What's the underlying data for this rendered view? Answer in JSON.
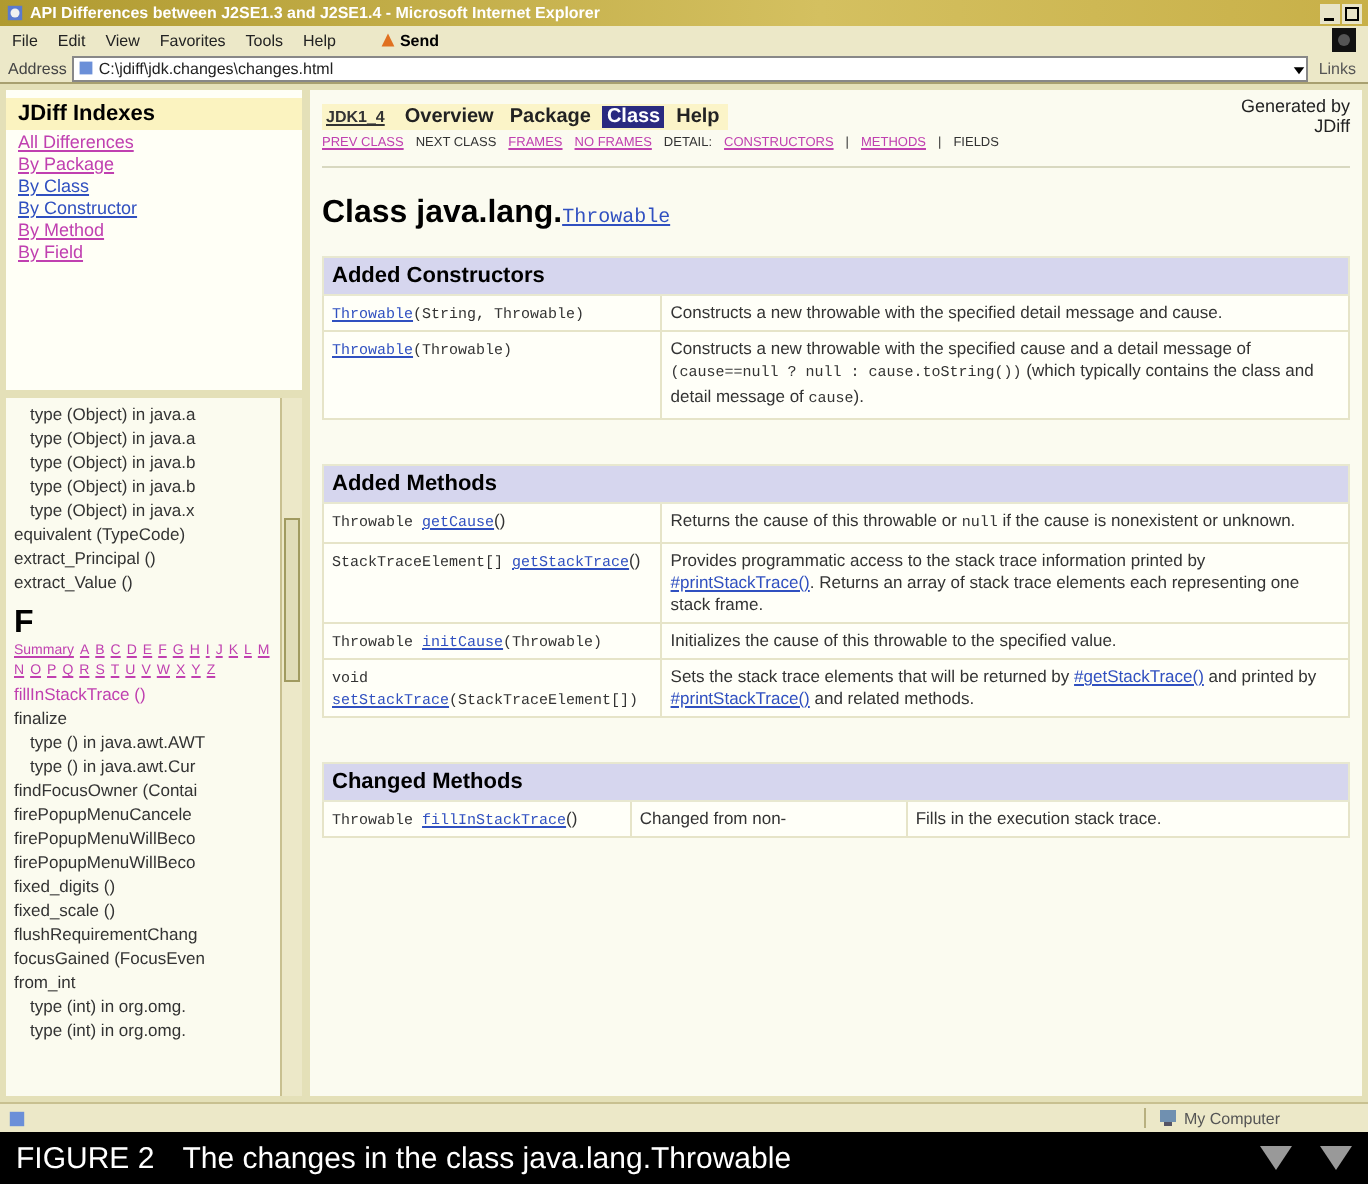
{
  "window": {
    "title": "API Differences between J2SE1.3 and J2SE1.4 - Microsoft Internet Explorer"
  },
  "menu": [
    "File",
    "Edit",
    "View",
    "Favorites",
    "Tools",
    "Help"
  ],
  "toolbar": {
    "send": "Send"
  },
  "address": {
    "label": "Address",
    "value": "C:\\jdiff\\jdk.changes\\changes.html",
    "links": "Links"
  },
  "index_frame": {
    "title": "JDiff Indexes",
    "links": [
      {
        "label": "All Differences",
        "visited": true
      },
      {
        "label": "By Package",
        "visited": true
      },
      {
        "label": "By Class",
        "visited": false
      },
      {
        "label": "By Constructor",
        "visited": false
      },
      {
        "label": "By Method",
        "visited": true
      },
      {
        "label": "By Field",
        "visited": true
      }
    ]
  },
  "list_frame": {
    "entries_top": [
      {
        "text": "type (Object) in java.a",
        "kind": "overload"
      },
      {
        "text": "type (Object) in java.a",
        "kind": "overload"
      },
      {
        "text": "type (Object) in java.b",
        "kind": "overload"
      },
      {
        "text": "type (Object) in java.b",
        "kind": "overload"
      },
      {
        "text": "type (Object) in java.x",
        "kind": "overload"
      },
      {
        "text": "equivalent (TypeCode)",
        "kind": "member"
      },
      {
        "text": "extract_Principal ()",
        "kind": "member"
      },
      {
        "text": "extract_Value ()",
        "kind": "member"
      }
    ],
    "letter": "F",
    "letter_links": [
      "Summary",
      "A",
      "B",
      "C",
      "D",
      "E",
      "F",
      "G",
      "H",
      "I",
      "J",
      "K",
      "L",
      "M",
      "N",
      "O",
      "P",
      "Q",
      "R",
      "S",
      "T",
      "U",
      "V",
      "W",
      "X",
      "Y",
      "Z"
    ],
    "entries": [
      {
        "text": "fillInStackTrace ()",
        "kind": "visited"
      },
      {
        "text": "finalize",
        "kind": "member"
      },
      {
        "text": "type () in java.awt.AWT",
        "kind": "overload"
      },
      {
        "text": "type () in java.awt.Cur",
        "kind": "overload"
      },
      {
        "text": "findFocusOwner (Contai",
        "kind": "member"
      },
      {
        "text": "firePopupMenuCancele",
        "kind": "member"
      },
      {
        "text": "firePopupMenuWillBeco",
        "kind": "member"
      },
      {
        "text": "firePopupMenuWillBeco",
        "kind": "member"
      },
      {
        "text": "fixed_digits ()",
        "kind": "member"
      },
      {
        "text": "fixed_scale ()",
        "kind": "member"
      },
      {
        "text": "flushRequirementChang",
        "kind": "member"
      },
      {
        "text": "focusGained (FocusEven",
        "kind": "member"
      },
      {
        "text": "from_int",
        "kind": "member"
      },
      {
        "text": "type (int) in org.omg.",
        "kind": "overload"
      },
      {
        "text": "type (int) in org.omg.",
        "kind": "overload"
      }
    ]
  },
  "nav": {
    "logo": "JDK1_4",
    "items": [
      {
        "label": "Overview",
        "selected": false
      },
      {
        "label": "Package",
        "selected": false
      },
      {
        "label": "Class",
        "selected": true
      },
      {
        "label": "Help",
        "selected": false
      }
    ],
    "subnav": [
      {
        "text": "PREV CLASS",
        "kind": "link"
      },
      {
        "text": "NEXT CLASS",
        "kind": "text"
      },
      {
        "text": "FRAMES",
        "kind": "link"
      },
      {
        "text": "NO FRAMES",
        "kind": "link"
      },
      {
        "text": "DETAIL:",
        "kind": "text"
      },
      {
        "text": "CONSTRUCTORS",
        "kind": "link"
      },
      {
        "text": "|",
        "kind": "text"
      },
      {
        "text": "METHODS",
        "kind": "link"
      },
      {
        "text": "|",
        "kind": "text"
      },
      {
        "text": "FIELDS",
        "kind": "text"
      }
    ],
    "generated": "Generated by JDiff"
  },
  "heading": {
    "prefix": "Class java.lang.",
    "link": "Throwable"
  },
  "sections": [
    {
      "title": "Added Constructors",
      "rows": [
        {
          "sig": [
            {
              "text": "Throwable",
              "kind": "link"
            },
            {
              "text": "(String, Throwable)",
              "kind": "code"
            }
          ],
          "cells": [
            [
              {
                "text": "Constructs a new throwable with the specified detail message and cause.",
                "kind": "text"
              }
            ]
          ]
        },
        {
          "sig": [
            {
              "text": "Throwable",
              "kind": "link"
            },
            {
              "text": "(Throwable)",
              "kind": "code"
            }
          ],
          "cells": [
            [
              {
                "text": "Constructs a new throwable with the specified cause and a detail message of ",
                "kind": "text"
              },
              {
                "text": "(cause==null ? null : cause.toString())",
                "kind": "code"
              },
              {
                "text": " (which typically contains the class and detail message of ",
                "kind": "text"
              },
              {
                "text": "cause",
                "kind": "code"
              },
              {
                "text": ").",
                "kind": "text"
              }
            ]
          ]
        }
      ]
    },
    {
      "title": "Added Methods",
      "rows": [
        {
          "sig": [
            {
              "text": "Throwable ",
              "kind": "code"
            },
            {
              "text": "getCause",
              "kind": "link"
            },
            {
              "text": "()",
              "kind": "text"
            }
          ],
          "cells": [
            [
              {
                "text": "Returns the cause of this throwable or ",
                "kind": "text"
              },
              {
                "text": "null",
                "kind": "code"
              },
              {
                "text": " if the cause is nonexistent or unknown.",
                "kind": "text"
              }
            ]
          ]
        },
        {
          "sig": [
            {
              "text": "StackTraceElement[] ",
              "kind": "code"
            },
            {
              "text": "getStackTrace",
              "kind": "link"
            },
            {
              "text": "()",
              "kind": "text"
            }
          ],
          "cells": [
            [
              {
                "text": "Provides programmatic access to the stack trace information printed by ",
                "kind": "text"
              },
              {
                "text": "#printStackTrace()",
                "kind": "link"
              },
              {
                "text": ". Returns an array of stack trace elements each representing one stack frame.",
                "kind": "text"
              }
            ]
          ]
        },
        {
          "sig": [
            {
              "text": "Throwable ",
              "kind": "code"
            },
            {
              "text": "initCause",
              "kind": "link"
            },
            {
              "text": "(Throwable)",
              "kind": "code"
            }
          ],
          "cells": [
            [
              {
                "text": "Initializes the cause of this throwable to the specified value.",
                "kind": "text"
              }
            ]
          ]
        },
        {
          "sig": [
            {
              "text": "void ",
              "kind": "code"
            },
            {
              "text": "setStackTrace",
              "kind": "link"
            },
            {
              "text": "(StackTraceElement[])",
              "kind": "code"
            }
          ],
          "cells": [
            [
              {
                "text": "Sets the stack trace elements that will be returned by ",
                "kind": "text"
              },
              {
                "text": "#getStackTrace()",
                "kind": "link"
              },
              {
                "text": " and printed by ",
                "kind": "text"
              },
              {
                "text": "#printStackTrace()",
                "kind": "link"
              },
              {
                "text": " and related methods.",
                "kind": "text"
              }
            ]
          ]
        }
      ]
    },
    {
      "title": "Changed Methods",
      "rows": [
        {
          "sig": [
            {
              "text": "Throwable ",
              "kind": "code"
            },
            {
              "text": "fillInStackTrace",
              "kind": "link"
            },
            {
              "text": "()",
              "kind": "text"
            }
          ],
          "cells": [
            [
              {
                "text": "Changed from non-",
                "kind": "text"
              }
            ],
            [
              {
                "text": "Fills in the execution stack trace.",
                "kind": "text"
              }
            ]
          ]
        }
      ]
    }
  ],
  "status_bar": {
    "zone": "My Computer"
  },
  "caption": {
    "label": "FIGURE 2",
    "text": "The changes in the class java.lang.Throwable"
  }
}
